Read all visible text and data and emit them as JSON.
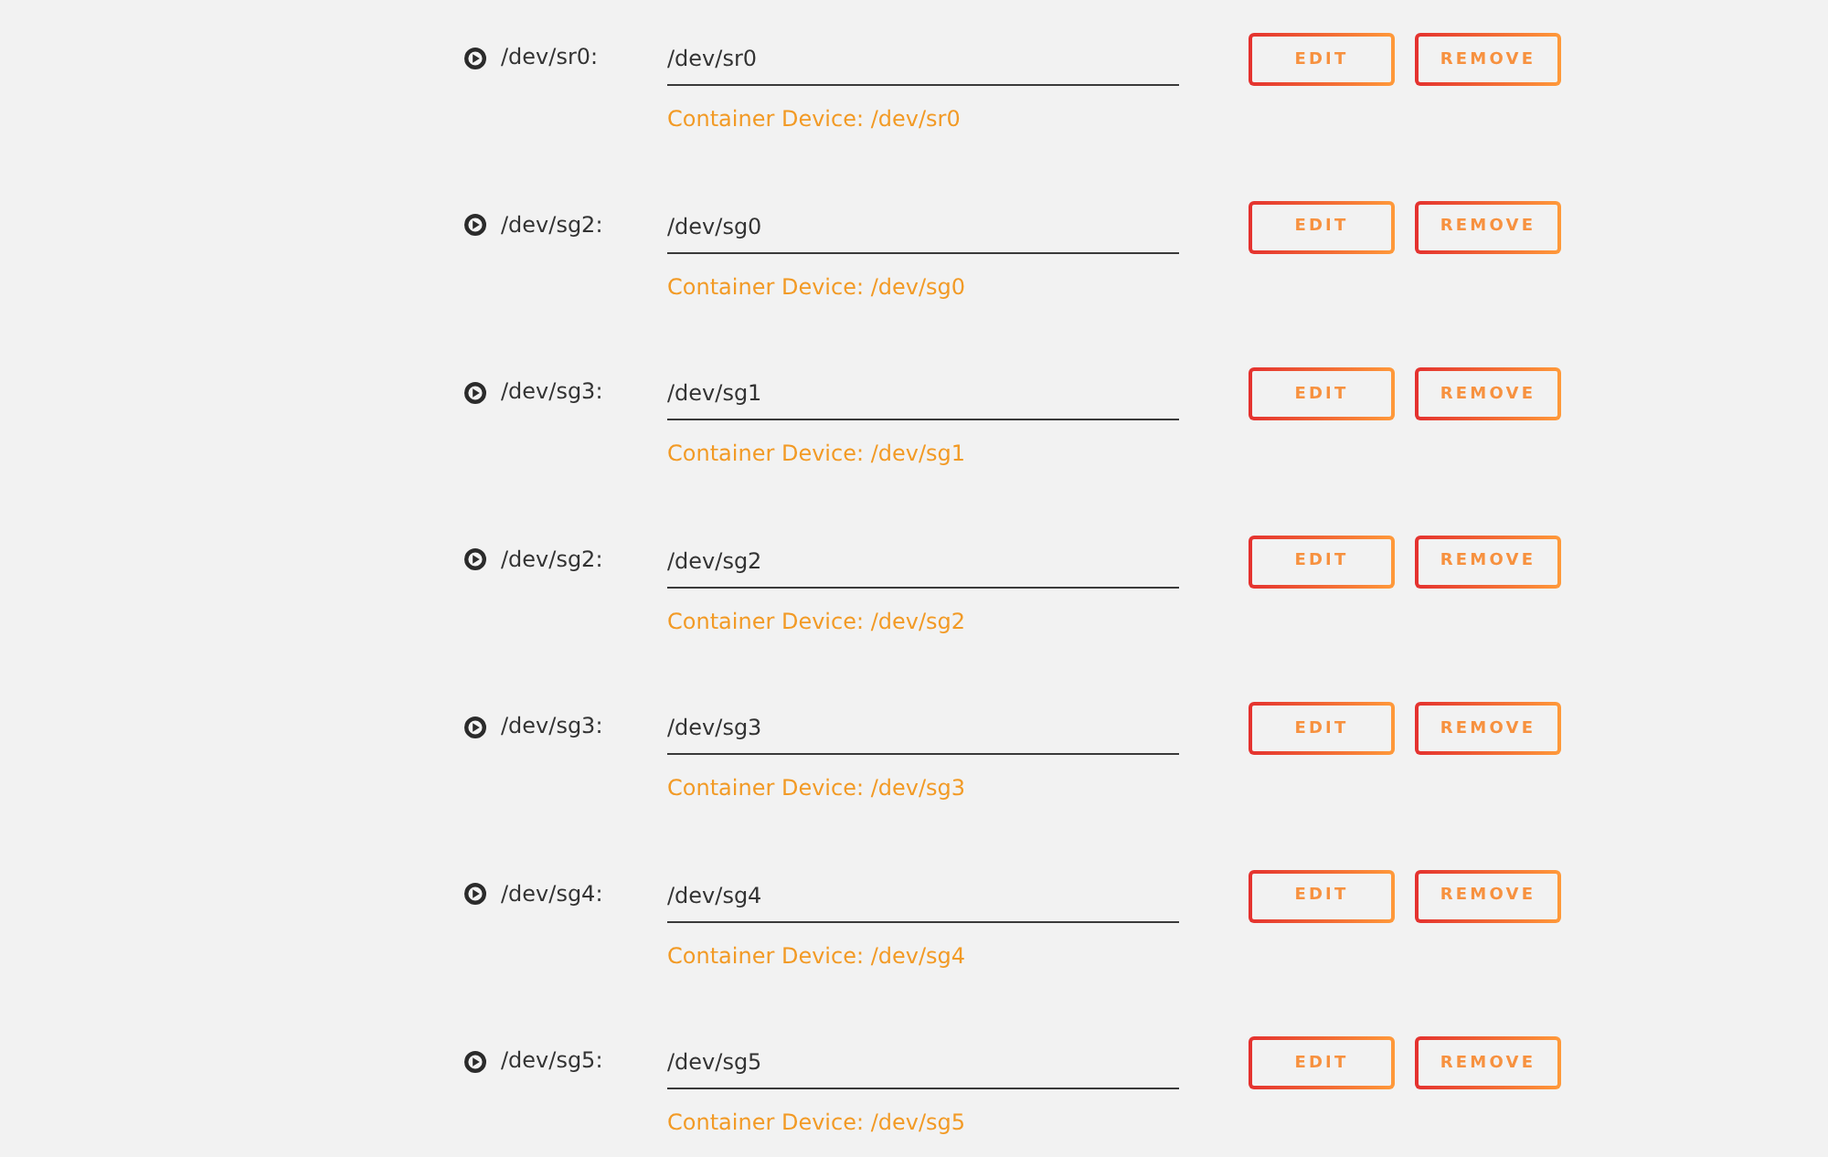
{
  "devices": [
    {
      "label": "/dev/sr0:",
      "value": "/dev/sr0",
      "container_device": "Container Device: /dev/sr0",
      "buttons": [
        "EDIT",
        "REMOVE"
      ]
    },
    {
      "label": "/dev/sg2:",
      "value": "/dev/sg0",
      "container_device": "Container Device: /dev/sg0",
      "buttons": [
        "EDIT",
        "REMOVE"
      ]
    },
    {
      "label": "/dev/sg3:",
      "value": "/dev/sg1",
      "container_device": "Container Device: /dev/sg1",
      "buttons": [
        "EDIT",
        "REMOVE"
      ]
    },
    {
      "label": "/dev/sg2:",
      "value": "/dev/sg2",
      "container_device": "Container Device: /dev/sg2",
      "buttons": [
        "EDIT",
        "REMOVE"
      ]
    },
    {
      "label": "/dev/sg3:",
      "value": "/dev/sg3",
      "container_device": "Container Device: /dev/sg3",
      "buttons": [
        "EDIT",
        "REMOVE"
      ]
    },
    {
      "label": "/dev/sg4:",
      "value": "/dev/sg4",
      "container_device": "Container Device: /dev/sg4",
      "buttons": [
        "EDIT",
        "REMOVE"
      ]
    },
    {
      "label": "/dev/sg5:",
      "value": "/dev/sg5",
      "container_device": "Container Device: /dev/sg5",
      "buttons": [
        "EDIT",
        "REMOVE"
      ]
    }
  ]
}
